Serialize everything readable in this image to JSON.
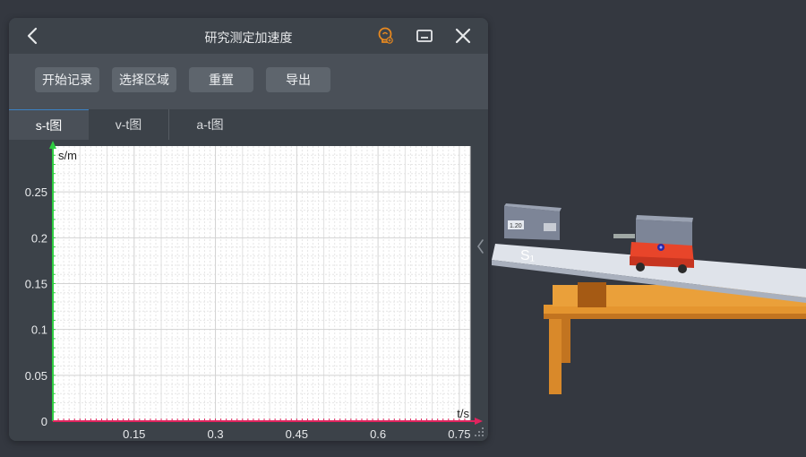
{
  "window": {
    "title": "研究测定加速度",
    "icons": [
      "chevron-left-icon",
      "lightbulb-icon",
      "minimize-icon",
      "close-icon"
    ],
    "accent_color": "#e8891f"
  },
  "toolbar": {
    "start_label": "开始记录",
    "select_label": "选择区域",
    "reset_label": "重置",
    "export_label": "导出"
  },
  "tabs": [
    {
      "label": "s-t图",
      "active": true
    },
    {
      "label": "v-t图",
      "active": false
    },
    {
      "label": "a-t图",
      "active": false
    }
  ],
  "chart_data": {
    "type": "line",
    "xlabel": "t/s",
    "ylabel": "s/m",
    "xlim": [
      0,
      0.77
    ],
    "ylim": [
      0,
      0.3
    ],
    "x_ticks": [
      "0.15",
      "0.3",
      "0.45",
      "0.6",
      "0.75"
    ],
    "y_ticks": [
      "0",
      "0.05",
      "0.1",
      "0.15",
      "0.2",
      "0.25"
    ],
    "grid": true,
    "series": [
      {
        "x": [
          0,
          0.77
        ],
        "y": [
          0,
          0
        ]
      }
    ],
    "axis_colors": {
      "x": "#e0245e",
      "y": "#2ecc40"
    }
  },
  "scene": {
    "sensor1_reading": "1.20",
    "sensor_label": "S₁",
    "colors": {
      "track": "#dfe3ea",
      "table": "#e4952f",
      "cart": "#e8452a"
    }
  }
}
